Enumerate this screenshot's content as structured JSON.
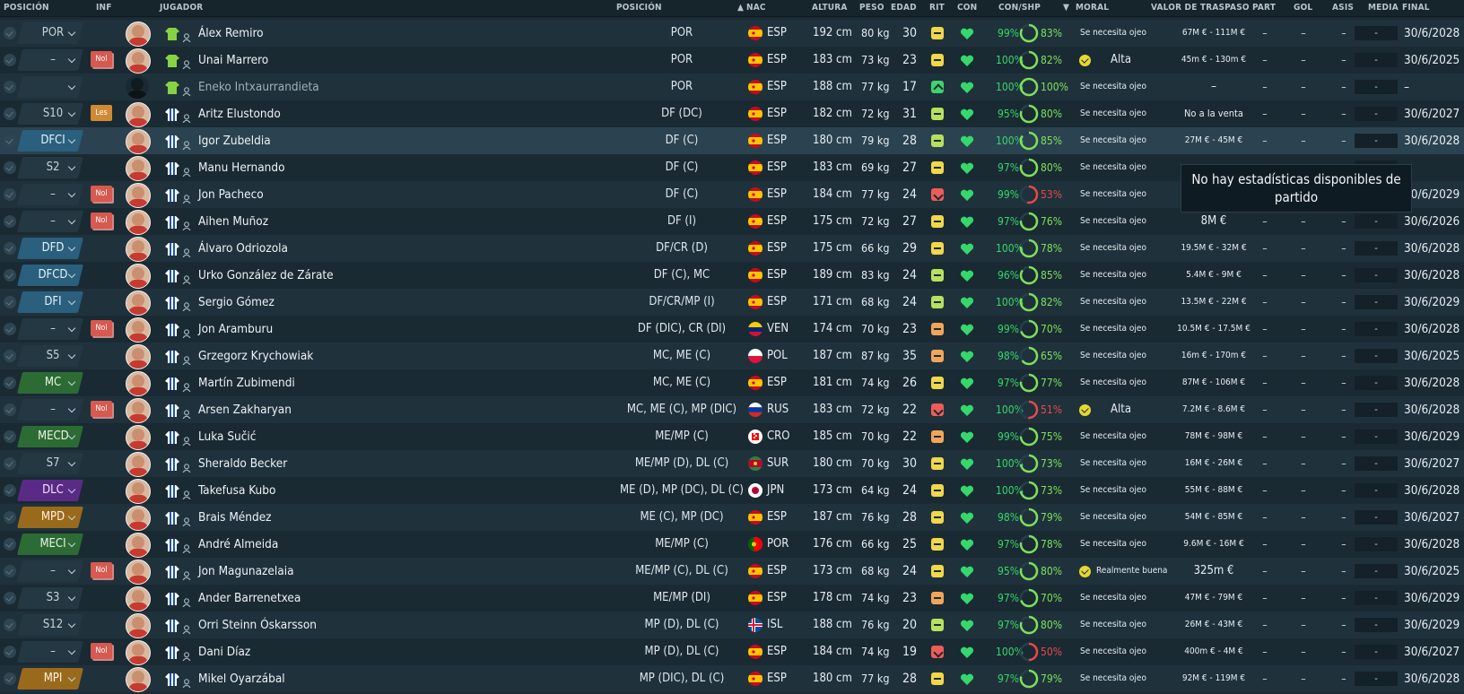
{
  "headers": {
    "posicion": "POSICIÓN",
    "inf": "INF",
    "jugador": "JUGADOR",
    "posicion2": "POSICIÓN",
    "nac": "NAC",
    "altura": "ALTURA",
    "peso": "PESO",
    "edad": "EDAD",
    "rit": "RIT",
    "con": "CON",
    "conshp": "CON/SHP",
    "moral": "MORAL",
    "valor": "VALOR DE TRASPASO",
    "part": "PART",
    "gol": "GOL",
    "asis": "ASIS",
    "media": "MEDIA",
    "final": "FINAL"
  },
  "tooltip": "No hay estadísticas disponibles de partido",
  "dash": "–",
  "media_placeholder": "-",
  "colors": {
    "condition_green": "#35d86a",
    "shape_green": "#7ee05a",
    "shape_red": "#e94848",
    "row_even": "#1f323c",
    "row_odd": "#1a2a33"
  },
  "players": [
    {
      "sel": "POR",
      "pos_style": "default",
      "inf": "",
      "kit": "gk",
      "name": "Álex Remiro",
      "pos": "POR",
      "flag": "esp",
      "nat": "ESP",
      "height": "192 cm",
      "weight": "80 kg",
      "age": "30",
      "rit": "y",
      "con": "99%",
      "shp": "83%",
      "shp_pct": 83,
      "moral_icon": false,
      "moral": "Se necesita ojeo",
      "moral_style": "small",
      "valor": "67M € - 111M €",
      "valor_style": "small",
      "final": "30/6/2028",
      "avatar": "std"
    },
    {
      "sel": "–",
      "pos_style": "default",
      "inf": "Nol",
      "kit": "gk",
      "name": "Unai Marrero",
      "pos": "POR",
      "flag": "esp",
      "nat": "ESP",
      "height": "183 cm",
      "weight": "73 kg",
      "age": "23",
      "rit": "y",
      "con": "100%",
      "shp": "82%",
      "shp_pct": 82,
      "moral_icon": true,
      "moral": "Alta",
      "moral_style": "big",
      "valor": "45m € - 130m €",
      "valor_style": "small",
      "final": "30/6/2025",
      "avatar": "std"
    },
    {
      "sel": "",
      "pos_style": "default",
      "inf": "",
      "kit": "gk",
      "name": "Eneko Intxaurrandieta",
      "pos": "POR",
      "flag": "esp",
      "nat": "ESP",
      "height": "188 cm",
      "weight": "77 kg",
      "age": "17",
      "rit": "gg",
      "con": "100%",
      "shp": "100%",
      "shp_pct": 100,
      "moral_icon": false,
      "moral": "Se necesita ojeo",
      "moral_style": "small",
      "valor": "–",
      "valor_style": "big",
      "final": "–",
      "avatar": "none",
      "dim": true
    },
    {
      "sel": "S10",
      "pos_style": "default",
      "inf": "Les",
      "kit": "out",
      "name": "Aritz Elustondo",
      "pos": "DF (DC)",
      "flag": "esp",
      "nat": "ESP",
      "height": "182 cm",
      "weight": "72 kg",
      "age": "31",
      "rit": "g",
      "con": "95%",
      "shp": "80%",
      "shp_pct": 80,
      "moral_icon": false,
      "moral": "Se necesita ojeo",
      "moral_style": "small",
      "valor": "No a la venta",
      "valor_style": "mid",
      "final": "30/6/2027",
      "avatar": "std"
    },
    {
      "sel": "DFCI",
      "pos_style": "blue",
      "inf": "",
      "kit": "out",
      "name": "Igor Zubeldia",
      "pos": "DF (C)",
      "flag": "esp",
      "nat": "ESP",
      "height": "180 cm",
      "weight": "79 kg",
      "age": "28",
      "rit": "g",
      "con": "100%",
      "shp": "85%",
      "shp_pct": 85,
      "moral_icon": false,
      "moral": "Se necesita ojeo",
      "moral_style": "small",
      "valor": "27M € - 45M €",
      "valor_style": "small",
      "final": "30/6/2028",
      "avatar": "std",
      "hl": true
    },
    {
      "sel": "S2",
      "pos_style": "default",
      "inf": "",
      "kit": "out",
      "name": "Manu Hernando",
      "pos": "DF (C)",
      "flag": "esp",
      "nat": "ESP",
      "height": "183 cm",
      "weight": "69 kg",
      "age": "27",
      "rit": "y",
      "con": "97%",
      "shp": "80%",
      "shp_pct": 80,
      "moral_icon": false,
      "moral": "Se necesita ojeo",
      "moral_style": "small",
      "valor": "",
      "valor_style": "small",
      "final": "",
      "avatar": "std"
    },
    {
      "sel": "–",
      "pos_style": "default",
      "inf": "Nol",
      "kit": "out",
      "name": "Jon Pacheco",
      "pos": "DF (C)",
      "flag": "esp",
      "nat": "ESP",
      "height": "184 cm",
      "weight": "77 kg",
      "age": "24",
      "rit": "r",
      "con": "99%",
      "shp": "53%",
      "shp_pct": 53,
      "shp_red": true,
      "moral_icon": false,
      "moral": "Se necesita ojeo",
      "moral_style": "small",
      "valor": "",
      "valor_style": "small",
      "final": "30/6/2029",
      "avatar": "std"
    },
    {
      "sel": "–",
      "pos_style": "default",
      "inf": "Nol",
      "kit": "out",
      "name": "Aihen Muñoz",
      "pos": "DF (I)",
      "flag": "esp",
      "nat": "ESP",
      "height": "175 cm",
      "weight": "72 kg",
      "age": "27",
      "rit": "y",
      "con": "97%",
      "shp": "76%",
      "shp_pct": 76,
      "moral_icon": false,
      "moral": "Se necesita ojeo",
      "moral_style": "small",
      "valor": "8M €",
      "valor_style": "big",
      "final": "30/6/2026",
      "avatar": "std"
    },
    {
      "sel": "DFD",
      "pos_style": "blue",
      "inf": "",
      "kit": "out",
      "name": "Álvaro Odriozola",
      "pos": "DF/CR (D)",
      "flag": "esp",
      "nat": "ESP",
      "height": "175 cm",
      "weight": "66 kg",
      "age": "29",
      "rit": "y",
      "con": "100%",
      "shp": "78%",
      "shp_pct": 78,
      "moral_icon": false,
      "moral": "Se necesita ojeo",
      "moral_style": "small",
      "valor": "19.5M € - 32M €",
      "valor_style": "small",
      "final": "30/6/2028",
      "avatar": "std"
    },
    {
      "sel": "DFCD",
      "pos_style": "blue",
      "inf": "",
      "kit": "out",
      "name": "Urko González de Zárate",
      "pos": "DF (C), MC",
      "flag": "esp",
      "nat": "ESP",
      "height": "189 cm",
      "weight": "83 kg",
      "age": "24",
      "rit": "g",
      "con": "96%",
      "shp": "85%",
      "shp_pct": 85,
      "moral_icon": false,
      "moral": "Se necesita ojeo",
      "moral_style": "small",
      "valor": "5.4M € - 9M €",
      "valor_style": "small",
      "final": "30/6/2028",
      "avatar": "std"
    },
    {
      "sel": "DFI",
      "pos_style": "blue",
      "inf": "",
      "kit": "out",
      "name": "Sergio Gómez",
      "pos": "DF/CR/MP (I)",
      "flag": "esp",
      "nat": "ESP",
      "height": "171 cm",
      "weight": "68 kg",
      "age": "24",
      "rit": "g",
      "con": "100%",
      "shp": "82%",
      "shp_pct": 82,
      "moral_icon": false,
      "moral": "Se necesita ojeo",
      "moral_style": "small",
      "valor": "13.5M € - 22M €",
      "valor_style": "small",
      "final": "30/6/2029",
      "avatar": "std"
    },
    {
      "sel": "–",
      "pos_style": "default",
      "inf": "Nol",
      "kit": "out",
      "name": "Jon Aramburu",
      "pos": "DF (DIC), CR (DI)",
      "flag": "ven",
      "nat": "VEN",
      "height": "174 cm",
      "weight": "70 kg",
      "age": "23",
      "rit": "o",
      "con": "99%",
      "shp": "70%",
      "shp_pct": 70,
      "moral_icon": false,
      "moral": "Se necesita ojeo",
      "moral_style": "small",
      "valor": "10.5M € - 17.5M €",
      "valor_style": "small",
      "final": "30/6/2028",
      "avatar": "std"
    },
    {
      "sel": "S5",
      "pos_style": "default",
      "inf": "",
      "kit": "out",
      "name": "Grzegorz Krychowiak",
      "pos": "MC, ME (C)",
      "flag": "pol",
      "nat": "POL",
      "height": "187 cm",
      "weight": "87 kg",
      "age": "35",
      "rit": "o",
      "con": "98%",
      "shp": "65%",
      "shp_pct": 65,
      "moral_icon": false,
      "moral": "Se necesita ojeo",
      "moral_style": "small",
      "valor": "16m € - 170m €",
      "valor_style": "small",
      "final": "30/6/2025",
      "avatar": "std"
    },
    {
      "sel": "MC",
      "pos_style": "green",
      "inf": "",
      "kit": "out",
      "name": "Martín Zubimendi",
      "pos": "MC, ME (C)",
      "flag": "esp",
      "nat": "ESP",
      "height": "181 cm",
      "weight": "74 kg",
      "age": "26",
      "rit": "y",
      "con": "97%",
      "shp": "77%",
      "shp_pct": 77,
      "moral_icon": false,
      "moral": "Se necesita ojeo",
      "moral_style": "small",
      "valor": "87M € - 106M €",
      "valor_style": "small",
      "final": "30/6/2028",
      "avatar": "std"
    },
    {
      "sel": "–",
      "pos_style": "default",
      "inf": "Nol",
      "kit": "out",
      "name": "Arsen Zakharyan",
      "pos": "MC, ME (C), MP (DIC)",
      "flag": "rus",
      "nat": "RUS",
      "height": "183 cm",
      "weight": "72 kg",
      "age": "22",
      "rit": "r",
      "con": "100%",
      "shp": "51%",
      "shp_pct": 51,
      "shp_red": true,
      "moral_icon": true,
      "moral": "Alta",
      "moral_style": "big",
      "valor": "7.2M € - 8.6M €",
      "valor_style": "small",
      "final": "30/6/2028",
      "avatar": "std"
    },
    {
      "sel": "MECD",
      "pos_style": "green",
      "inf": "",
      "kit": "out",
      "name": "Luka Sučić",
      "pos": "ME/MP (C)",
      "flag": "cro",
      "nat": "CRO",
      "height": "185 cm",
      "weight": "70 kg",
      "age": "22",
      "rit": "o",
      "con": "99%",
      "shp": "75%",
      "shp_pct": 75,
      "moral_icon": false,
      "moral": "Se necesita ojeo",
      "moral_style": "small",
      "valor": "78M € - 98M €",
      "valor_style": "small",
      "final": "30/6/2029",
      "avatar": "std"
    },
    {
      "sel": "S7",
      "pos_style": "default",
      "inf": "",
      "kit": "out",
      "name": "Sheraldo Becker",
      "pos": "ME/MP (D), DL (C)",
      "flag": "sur",
      "nat": "SUR",
      "height": "180 cm",
      "weight": "70 kg",
      "age": "30",
      "rit": "y",
      "con": "100%",
      "shp": "73%",
      "shp_pct": 73,
      "moral_icon": false,
      "moral": "Se necesita ojeo",
      "moral_style": "small",
      "valor": "16M € - 26M €",
      "valor_style": "small",
      "final": "30/6/2027",
      "avatar": "dark"
    },
    {
      "sel": "DLC",
      "pos_style": "purple",
      "inf": "",
      "kit": "out",
      "name": "Takefusa Kubo",
      "pos": "ME (D), MP (DC), DL (C)",
      "flag": "jpn",
      "nat": "JPN",
      "height": "173 cm",
      "weight": "64 kg",
      "age": "24",
      "rit": "y",
      "con": "100%",
      "shp": "73%",
      "shp_pct": 73,
      "moral_icon": false,
      "moral": "Se necesita ojeo",
      "moral_style": "small",
      "valor": "55M € - 88M €",
      "valor_style": "small",
      "final": "30/6/2028",
      "avatar": "std"
    },
    {
      "sel": "MPD",
      "pos_style": "orange",
      "inf": "",
      "kit": "out",
      "name": "Brais Méndez",
      "pos": "ME (C), MP (DC)",
      "flag": "esp",
      "nat": "ESP",
      "height": "187 cm",
      "weight": "76 kg",
      "age": "28",
      "rit": "y",
      "con": "98%",
      "shp": "79%",
      "shp_pct": 79,
      "moral_icon": false,
      "moral": "Se necesita ojeo",
      "moral_style": "small",
      "valor": "54M € - 85M €",
      "valor_style": "small",
      "final": "30/6/2027",
      "avatar": "std"
    },
    {
      "sel": "MECI",
      "pos_style": "green",
      "inf": "",
      "kit": "out",
      "name": "André Almeida",
      "pos": "ME/MP (C)",
      "flag": "por",
      "nat": "POR",
      "height": "176 cm",
      "weight": "66 kg",
      "age": "25",
      "rit": "y",
      "con": "97%",
      "shp": "78%",
      "shp_pct": 78,
      "moral_icon": false,
      "moral": "Se necesita ojeo",
      "moral_style": "small",
      "valor": "9.6M € - 16M €",
      "valor_style": "small",
      "final": "30/6/2028",
      "avatar": "std"
    },
    {
      "sel": "–",
      "pos_style": "default",
      "inf": "Nol",
      "kit": "out",
      "name": "Jon Magunazelaia",
      "pos": "ME/MP (C), DL (C)",
      "flag": "esp",
      "nat": "ESP",
      "height": "173 cm",
      "weight": "68 kg",
      "age": "24",
      "rit": "y",
      "con": "95%",
      "shp": "80%",
      "shp_pct": 80,
      "moral_icon": true,
      "moral": "Realmente buena",
      "moral_style": "mid",
      "valor": "325m €",
      "valor_style": "big",
      "final": "30/6/2025",
      "avatar": "std"
    },
    {
      "sel": "S3",
      "pos_style": "default",
      "inf": "",
      "kit": "out",
      "name": "Ander Barrenetxea",
      "pos": "ME/MP (DI)",
      "flag": "esp",
      "nat": "ESP",
      "height": "178 cm",
      "weight": "74 kg",
      "age": "23",
      "rit": "o",
      "con": "97%",
      "shp": "70%",
      "shp_pct": 70,
      "moral_icon": false,
      "moral": "Se necesita ojeo",
      "moral_style": "small",
      "valor": "47M € - 79M €",
      "valor_style": "small",
      "final": "30/6/2029",
      "avatar": "std"
    },
    {
      "sel": "S12",
      "pos_style": "default",
      "inf": "",
      "kit": "out",
      "name": "Orri Steinn Óskarsson",
      "pos": "MP (D), DL (C)",
      "flag": "isl",
      "nat": "ISL",
      "height": "188 cm",
      "weight": "76 kg",
      "age": "20",
      "rit": "g",
      "con": "97%",
      "shp": "80%",
      "shp_pct": 80,
      "moral_icon": false,
      "moral": "Se necesita ojeo",
      "moral_style": "small",
      "valor": "26M € - 43M €",
      "valor_style": "small",
      "final": "30/6/2029",
      "avatar": "std"
    },
    {
      "sel": "–",
      "pos_style": "default",
      "inf": "Nol",
      "kit": "out",
      "name": "Dani Díaz",
      "pos": "MP (D), DL (C)",
      "flag": "esp",
      "nat": "ESP",
      "height": "184 cm",
      "weight": "74 kg",
      "age": "19",
      "rit": "r",
      "con": "100%",
      "shp": "50%",
      "shp_pct": 50,
      "shp_red": true,
      "moral_icon": false,
      "moral": "Se necesita ojeo",
      "moral_style": "small",
      "valor": "400m € - 4M €",
      "valor_style": "small",
      "final": "30/6/2027",
      "avatar": "std"
    },
    {
      "sel": "MPI",
      "pos_style": "orange",
      "inf": "",
      "kit": "out",
      "name": "Mikel Oyarzábal",
      "pos": "MP (DIC), DL (C)",
      "flag": "esp",
      "nat": "ESP",
      "height": "180 cm",
      "weight": "77 kg",
      "age": "28",
      "rit": "y",
      "con": "97%",
      "shp": "79%",
      "shp_pct": 79,
      "moral_icon": false,
      "moral": "Se necesita ojeo",
      "moral_style": "small",
      "valor": "92M € - 119M €",
      "valor_style": "small",
      "final": "30/6/2028",
      "avatar": "std"
    }
  ]
}
